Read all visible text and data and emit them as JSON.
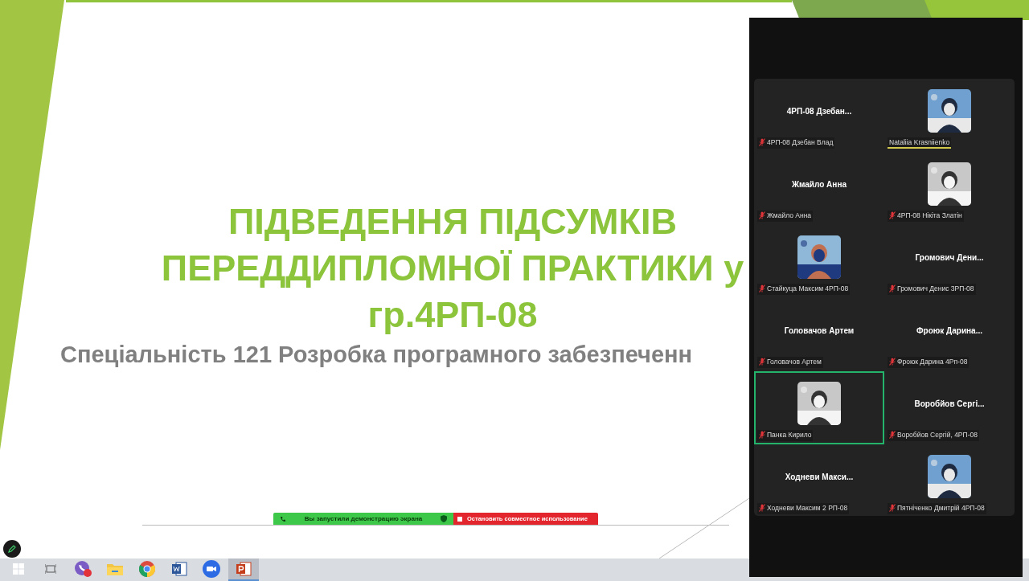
{
  "slide": {
    "title_lines": [
      "ПІДВЕДЕННЯ ПІДСУМКІВ",
      "ПЕРЕДДИПЛОМНОЇ ПРАКТИКИ у",
      "гр.4РП-08"
    ],
    "subtitle": "Спеціальність 121 Розробка програмного забезпеченн"
  },
  "participants": [
    {
      "kind": "name",
      "display": "4РП-08  Дзебан...",
      "label": "4РП-08 Дзебан Влад",
      "muted": true,
      "speaking": false,
      "active": false
    },
    {
      "kind": "picture",
      "label": "Nataliia Krasniienko",
      "muted": false,
      "speaking": true,
      "active": false
    },
    {
      "kind": "name",
      "display": "Жмайло Анна",
      "label": "Жмайло Анна",
      "muted": true,
      "speaking": false,
      "active": false
    },
    {
      "kind": "picture",
      "label": "4РП-08 Нікіта Златін",
      "muted": true,
      "speaking": false,
      "active": false
    },
    {
      "kind": "picture",
      "label": "Стайкуца Максим 4РП-08",
      "muted": true,
      "speaking": false,
      "active": false
    },
    {
      "kind": "name",
      "display": "Громович  Дени...",
      "label": "Громович Денис 3РП-08",
      "muted": true,
      "speaking": false,
      "active": false
    },
    {
      "kind": "name",
      "display": "Головачов Артем",
      "label": "Головачов Артем",
      "muted": true,
      "speaking": false,
      "active": false
    },
    {
      "kind": "name",
      "display": "Фроюк  Дарина...",
      "label": "Фроюк Дарина 4Рп-08",
      "muted": true,
      "speaking": false,
      "active": false
    },
    {
      "kind": "picture",
      "label": "Панка Кирило",
      "muted": true,
      "speaking": false,
      "active": true
    },
    {
      "kind": "name",
      "display": "Воробйов  Сергі...",
      "label": "Воробйов Сергій, 4РП-08",
      "muted": true,
      "speaking": false,
      "active": false
    },
    {
      "kind": "name",
      "display": "Ходневи  Макси...",
      "label": "Ходневи Максим 2 РП-08",
      "muted": true,
      "speaking": false,
      "active": false
    },
    {
      "kind": "picture",
      "label": "Пятніченко Дмитрій 4РП-08",
      "muted": true,
      "speaking": false,
      "active": false
    }
  ],
  "share_bar": {
    "status": "Вы запустили демонстрацию экрана",
    "stop": "Остановить совместное использование"
  },
  "taskbar": {
    "items": [
      {
        "kind": "viber",
        "selected": false
      },
      {
        "kind": "folder",
        "selected": false
      },
      {
        "kind": "chrome",
        "selected": false
      },
      {
        "kind": "word",
        "selected": false
      },
      {
        "kind": "zoom",
        "selected": false
      },
      {
        "kind": "powerpoint",
        "selected": true
      }
    ]
  }
}
